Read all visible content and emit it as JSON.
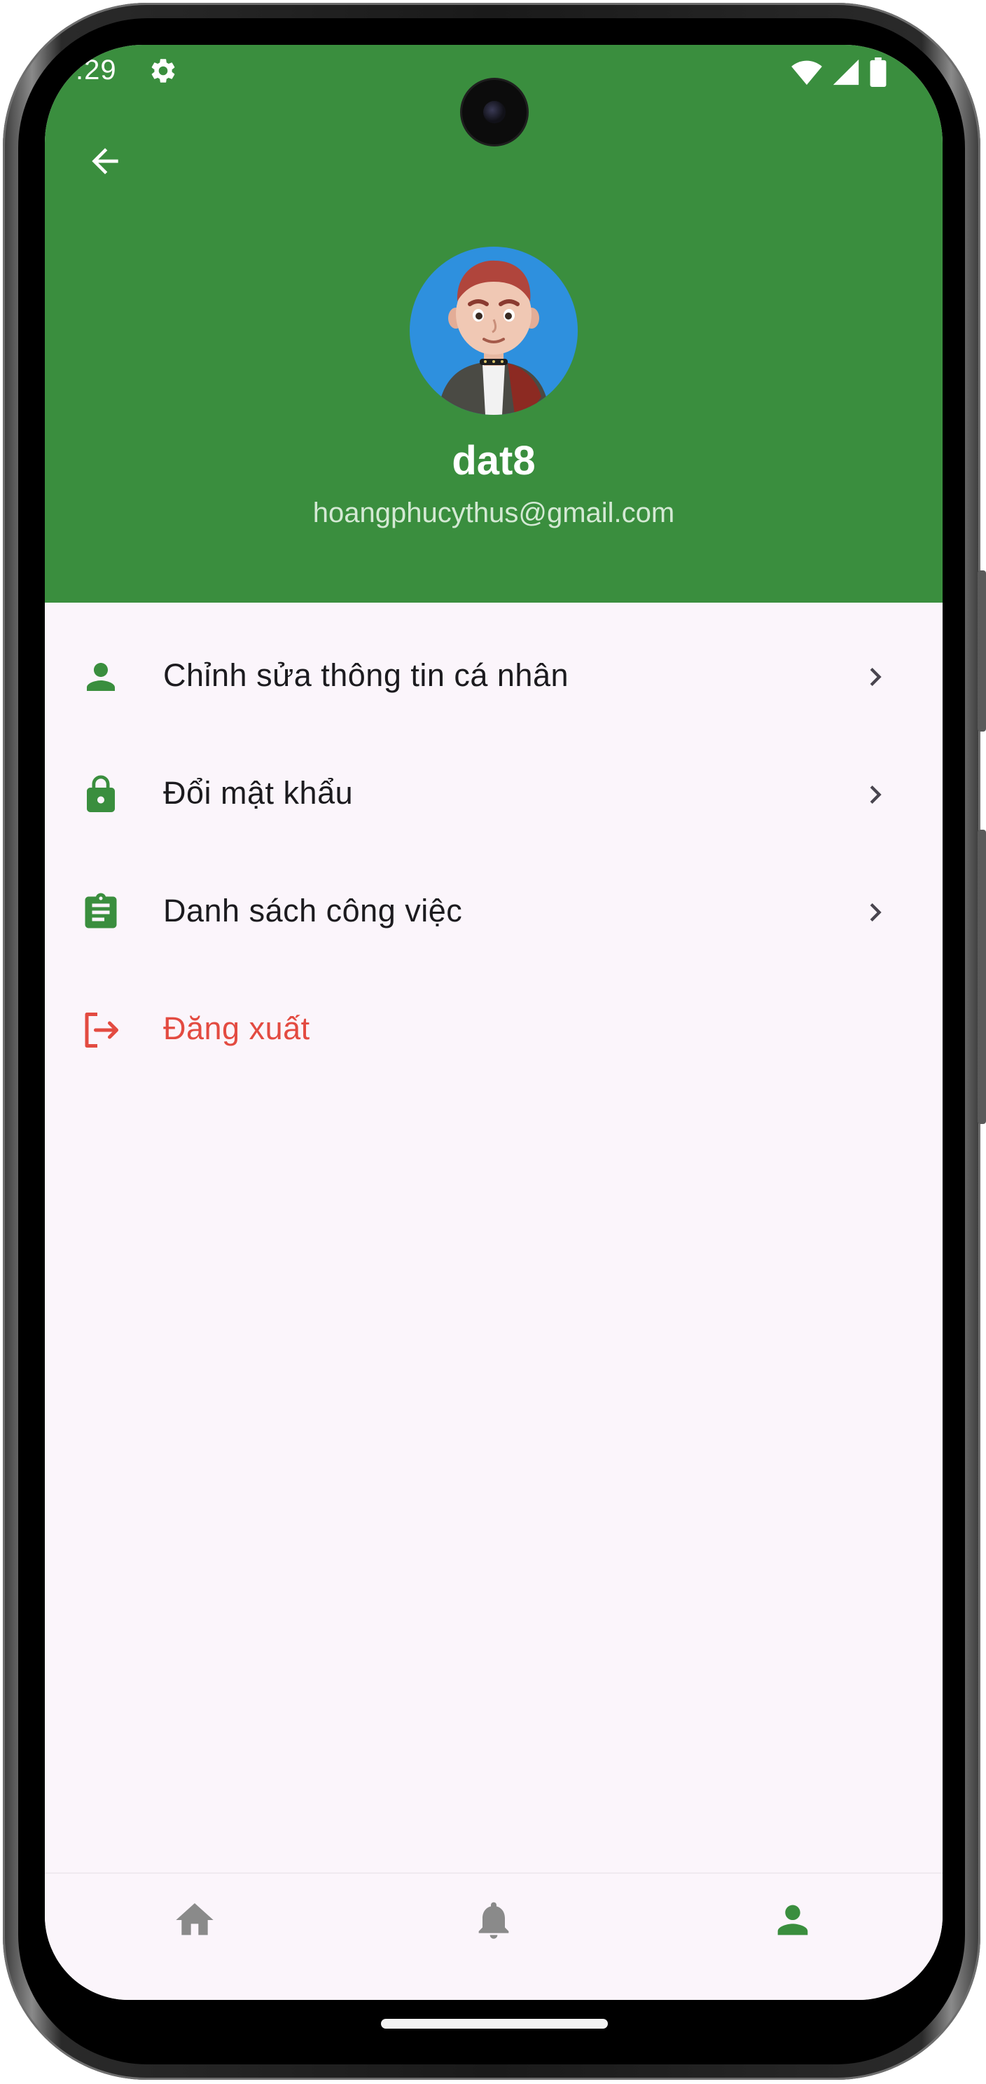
{
  "status_bar": {
    "time": ":29",
    "settings_icon": "gear-icon",
    "icons": [
      "wifi-icon",
      "cell-signal-icon",
      "battery-icon"
    ]
  },
  "header": {
    "back_icon": "arrow-left-icon",
    "avatar": "avatar",
    "username": "dat8",
    "email": "hoangphucythus@gmail.com",
    "background_color": "#3a8e3e"
  },
  "menu": {
    "items": [
      {
        "label": "Chỉnh sửa thông tin cá nhân",
        "icon": "person-icon",
        "chevron": "chevron-right-icon"
      },
      {
        "label": "Đổi mật khẩu",
        "icon": "lock-icon",
        "chevron": "chevron-right-icon"
      },
      {
        "label": "Danh sách công việc",
        "icon": "clipboard-icon",
        "chevron": "chevron-right-icon"
      },
      {
        "label": "Đăng xuất",
        "icon": "logout-icon"
      }
    ],
    "accent_color": "#3a8e3e",
    "danger_color": "#e34b41"
  },
  "bottom_nav": {
    "items": [
      {
        "icon": "home-icon",
        "active": false
      },
      {
        "icon": "bell-icon",
        "active": false
      },
      {
        "icon": "person-icon",
        "active": true
      }
    ],
    "active_color": "#3a8e3e",
    "inactive_color": "#8a8a8a"
  }
}
